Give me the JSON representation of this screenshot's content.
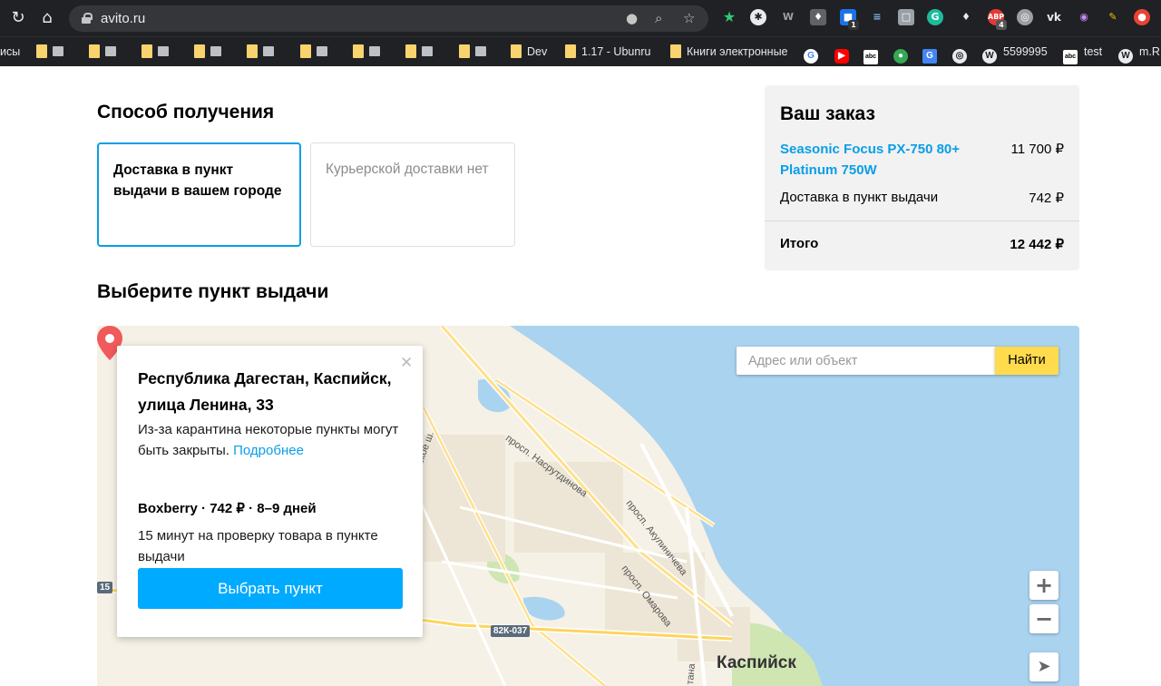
{
  "browser": {
    "url": "avito.ru",
    "bookmarks": {
      "cut": "исы",
      "dev": "Dev",
      "ubunru": "1.17 - Ubunru",
      "books": "Книги электронные",
      "num": "5599995",
      "test": "test",
      "mr": "m.R"
    },
    "badges": {
      "abp": "ABP",
      "abp_count": "4",
      "ext_count": "1"
    }
  },
  "delivery": {
    "heading": "Способ получения",
    "option_pickup": "Доставка в пункт выдачи в вашем городе",
    "option_courier": "Курьерской доставки нет"
  },
  "order": {
    "title": "Ваш заказ",
    "product_name": "Seasonic Focus PX-750 80+ Platinum 750W",
    "product_price": "11 700 ₽",
    "delivery_label": "Доставка в пункт выдачи",
    "delivery_price": "742 ₽",
    "total_label": "Итого",
    "total_price": "12 442 ₽"
  },
  "pickup": {
    "heading": "Выберите пункт выдачи",
    "search_placeholder": "Адрес или объект",
    "search_button": "Найти",
    "popup": {
      "address": "Республика Дагестан, Каспийск, улица Ленина, 33",
      "notice": "Из-за карантина некоторые пункты могут быть закрыты.",
      "notice_link": "Подробнее",
      "service": "Boxberry · 742 ₽ · 8–9 дней",
      "info": "15 минут на проверку товара в пункте выдачи",
      "select_button": "Выбрать пункт"
    },
    "map_labels": {
      "street1": "просп. Насрутдинова",
      "street2": "просп. Акулиничева",
      "street3": "просп. Омарова",
      "street4": "ское ш.",
      "street5": "тана",
      "road": "82К-037",
      "road2": "15",
      "city": "Каспийск"
    }
  }
}
